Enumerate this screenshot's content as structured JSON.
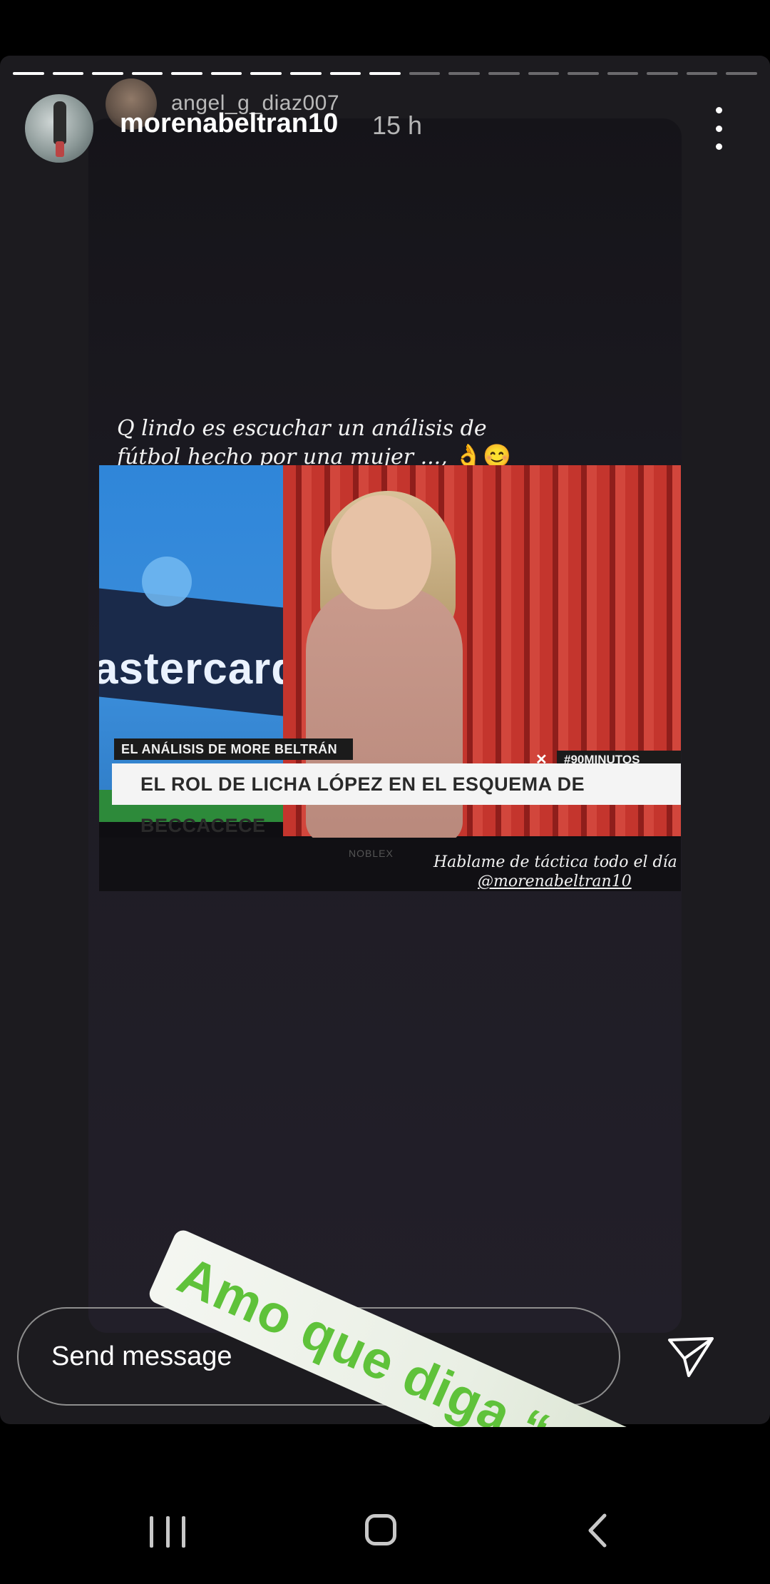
{
  "story": {
    "progress": {
      "segments": 19,
      "completed": 10
    },
    "original_author": "angel_g_diaz007",
    "username": "morenabeltran10",
    "time_ago": "15 h",
    "caption_top_line1": "Q lindo es escuchar un análisis  de",
    "caption_top_line2": "fútbol  hecho por una mujer ...,",
    "caption_top_emoji": "👌😊",
    "tv": {
      "ad_text": "astercard",
      "lower_third_small": "EL ANÁLISIS DE MORE BELTRÁN",
      "lower_third_main": "EL ROL DE LICHA LÓPEZ EN EL ESQUEMA DE BECCACECE",
      "hashtag": "#90MINUTOS",
      "x_mark": "✕",
      "brand": "NOBLEX"
    },
    "caption_bottom_line1": "Hablame de  táctica todo el día",
    "caption_bottom_mention": "@morenabeltran10",
    "sticker_text": "Amo que diga “rol”"
  },
  "composer": {
    "placeholder": "Send message"
  },
  "icons": {
    "more": "more-vertical-icon",
    "send": "send-icon",
    "nav_recent": "recent-apps-icon",
    "nav_home": "home-icon",
    "nav_back": "back-icon"
  },
  "colors": {
    "sticker_text": "#5fc23a",
    "background": "#1c1b1f"
  }
}
